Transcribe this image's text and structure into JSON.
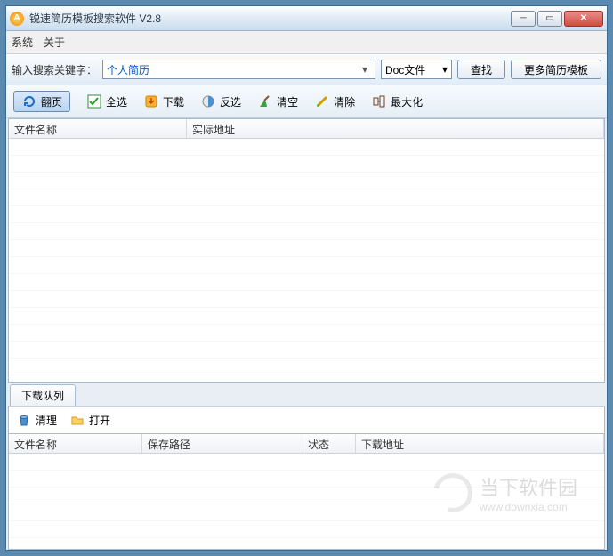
{
  "title": "锐速简历模板搜索软件  V2.8",
  "menu": {
    "system": "系统",
    "about": "关于"
  },
  "search": {
    "label": "输入搜索关键字：",
    "value": "个人简历",
    "filetype": "Doc文件",
    "find": "查找",
    "more": "更多简历模板"
  },
  "toolbar": {
    "page": "翻页",
    "selectall": "全选",
    "download": "下载",
    "invert": "反选",
    "empty": "清空",
    "clear": "清除",
    "maximize": "最大化"
  },
  "results": {
    "col_name": "文件名称",
    "col_url": "实际地址"
  },
  "queue": {
    "tab": "下载队列",
    "cleanup": "清理",
    "open": "打开",
    "col_name": "文件名称",
    "col_path": "保存路径",
    "col_status": "状态",
    "col_url": "下载地址"
  },
  "watermark": {
    "name": "当下软件园",
    "url": "www.downxia.com"
  }
}
